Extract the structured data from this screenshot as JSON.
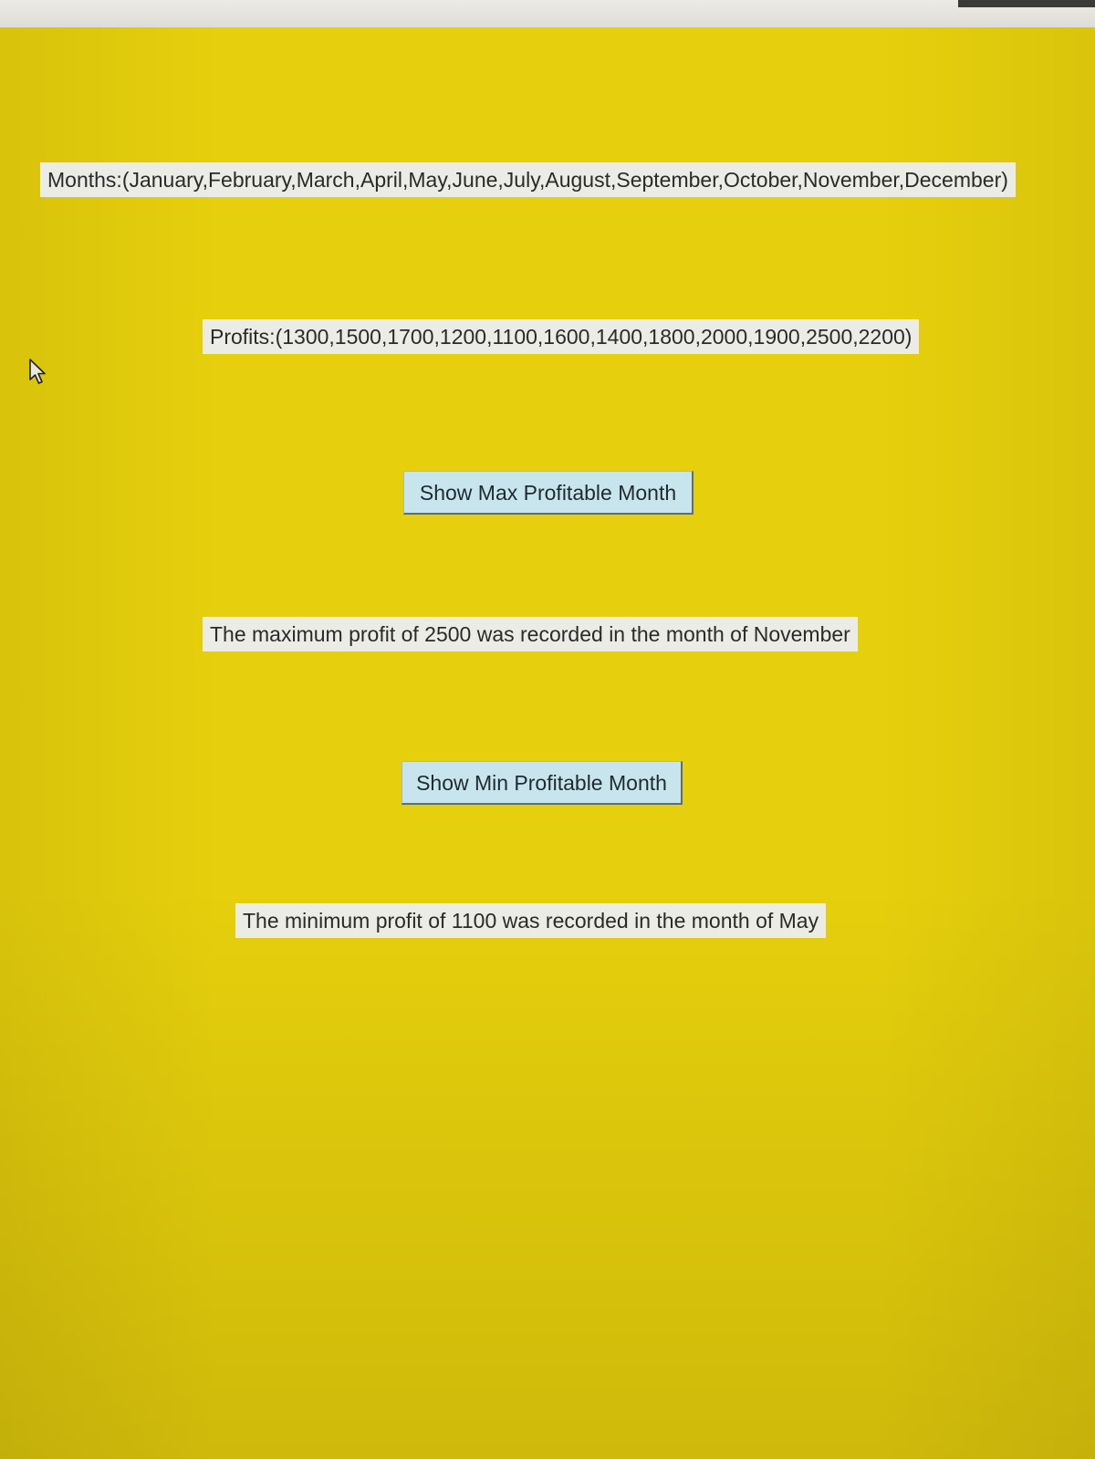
{
  "labels": {
    "months": "Months:(January,February,March,April,May,June,July,August,September,October,November,December)",
    "profits": "Profits:(1300,1500,1700,1200,1100,1600,1400,1800,2000,1900,2500,2200)"
  },
  "buttons": {
    "max_label": "Show Max Profitable Month",
    "min_label": "Show Min Profitable Month"
  },
  "results": {
    "max": "The maximum profit of 2500 was recorded in the month of November",
    "min": "The minimum profit of 1100 was recorded in the month of May"
  },
  "colors": {
    "background": "#e6cf0c",
    "label_bg": "#ecece6",
    "button_bg": "#c8e5ee"
  },
  "icons": {
    "cursor": "mouse-pointer-icon"
  }
}
